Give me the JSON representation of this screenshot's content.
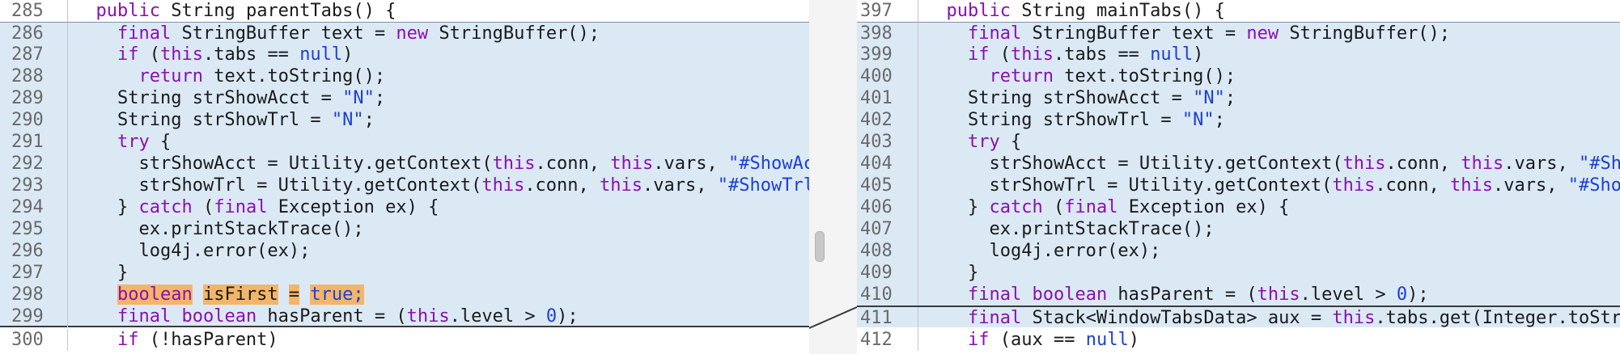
{
  "left": {
    "lines": [
      {
        "num": "285",
        "code": "  public String parentTabs() {"
      },
      {
        "num": "286",
        "code": "    final StringBuffer text = new StringBuffer();"
      },
      {
        "num": "287",
        "code": "    if (this.tabs == null)"
      },
      {
        "num": "288",
        "code": "      return text.toString();"
      },
      {
        "num": "289",
        "code": "    String strShowAcct = \"N\";"
      },
      {
        "num": "290",
        "code": "    String strShowTrl = \"N\";"
      },
      {
        "num": "291",
        "code": "    try {"
      },
      {
        "num": "292",
        "code": "      strShowAcct = Utility.getContext(this.conn, this.vars, \"#ShowAcct\","
      },
      {
        "num": "293",
        "code": "      strShowTrl = Utility.getContext(this.conn, this.vars, \"#ShowTrl\", th"
      },
      {
        "num": "294",
        "code": "    } catch (final Exception ex) {"
      },
      {
        "num": "295",
        "code": "      ex.printStackTrace();"
      },
      {
        "num": "296",
        "code": "      log4j.error(ex);"
      },
      {
        "num": "297",
        "code": "    }"
      },
      {
        "num": "298",
        "code": "    boolean isFirst = true;"
      },
      {
        "num": "299",
        "code": "    final boolean hasParent = (this.level > 0);"
      },
      {
        "num": "300",
        "code": "    if (!hasParent)"
      }
    ]
  },
  "right": {
    "lines": [
      {
        "num": "397",
        "code": "  public String mainTabs() {"
      },
      {
        "num": "398",
        "code": "    final StringBuffer text = new StringBuffer();"
      },
      {
        "num": "399",
        "code": "    if (this.tabs == null)"
      },
      {
        "num": "400",
        "code": "      return text.toString();"
      },
      {
        "num": "401",
        "code": "    String strShowAcct = \"N\";"
      },
      {
        "num": "402",
        "code": "    String strShowTrl = \"N\";"
      },
      {
        "num": "403",
        "code": "    try {"
      },
      {
        "num": "404",
        "code": "      strShowAcct = Utility.getContext(this.conn, this.vars, \"#ShowAcct"
      },
      {
        "num": "405",
        "code": "      strShowTrl = Utility.getContext(this.conn, this.vars, \"#ShowTrl\""
      },
      {
        "num": "406",
        "code": "    } catch (final Exception ex) {"
      },
      {
        "num": "407",
        "code": "      ex.printStackTrace();"
      },
      {
        "num": "408",
        "code": "      log4j.error(ex);"
      },
      {
        "num": "409",
        "code": "    }"
      },
      {
        "num": "410",
        "code": "    final boolean hasParent = (this.level > 0);"
      },
      {
        "num": "411",
        "code": "    final Stack<WindowTabsData> aux = this.tabs.get(Integer.toString(th"
      },
      {
        "num": "412",
        "code": "    if (aux == null)"
      }
    ]
  },
  "colors": {
    "changed_bg": "#dbe9f5",
    "highlight": "#f3b56a",
    "keyword": "#8b0fb0",
    "string": "#1b3fd6"
  }
}
